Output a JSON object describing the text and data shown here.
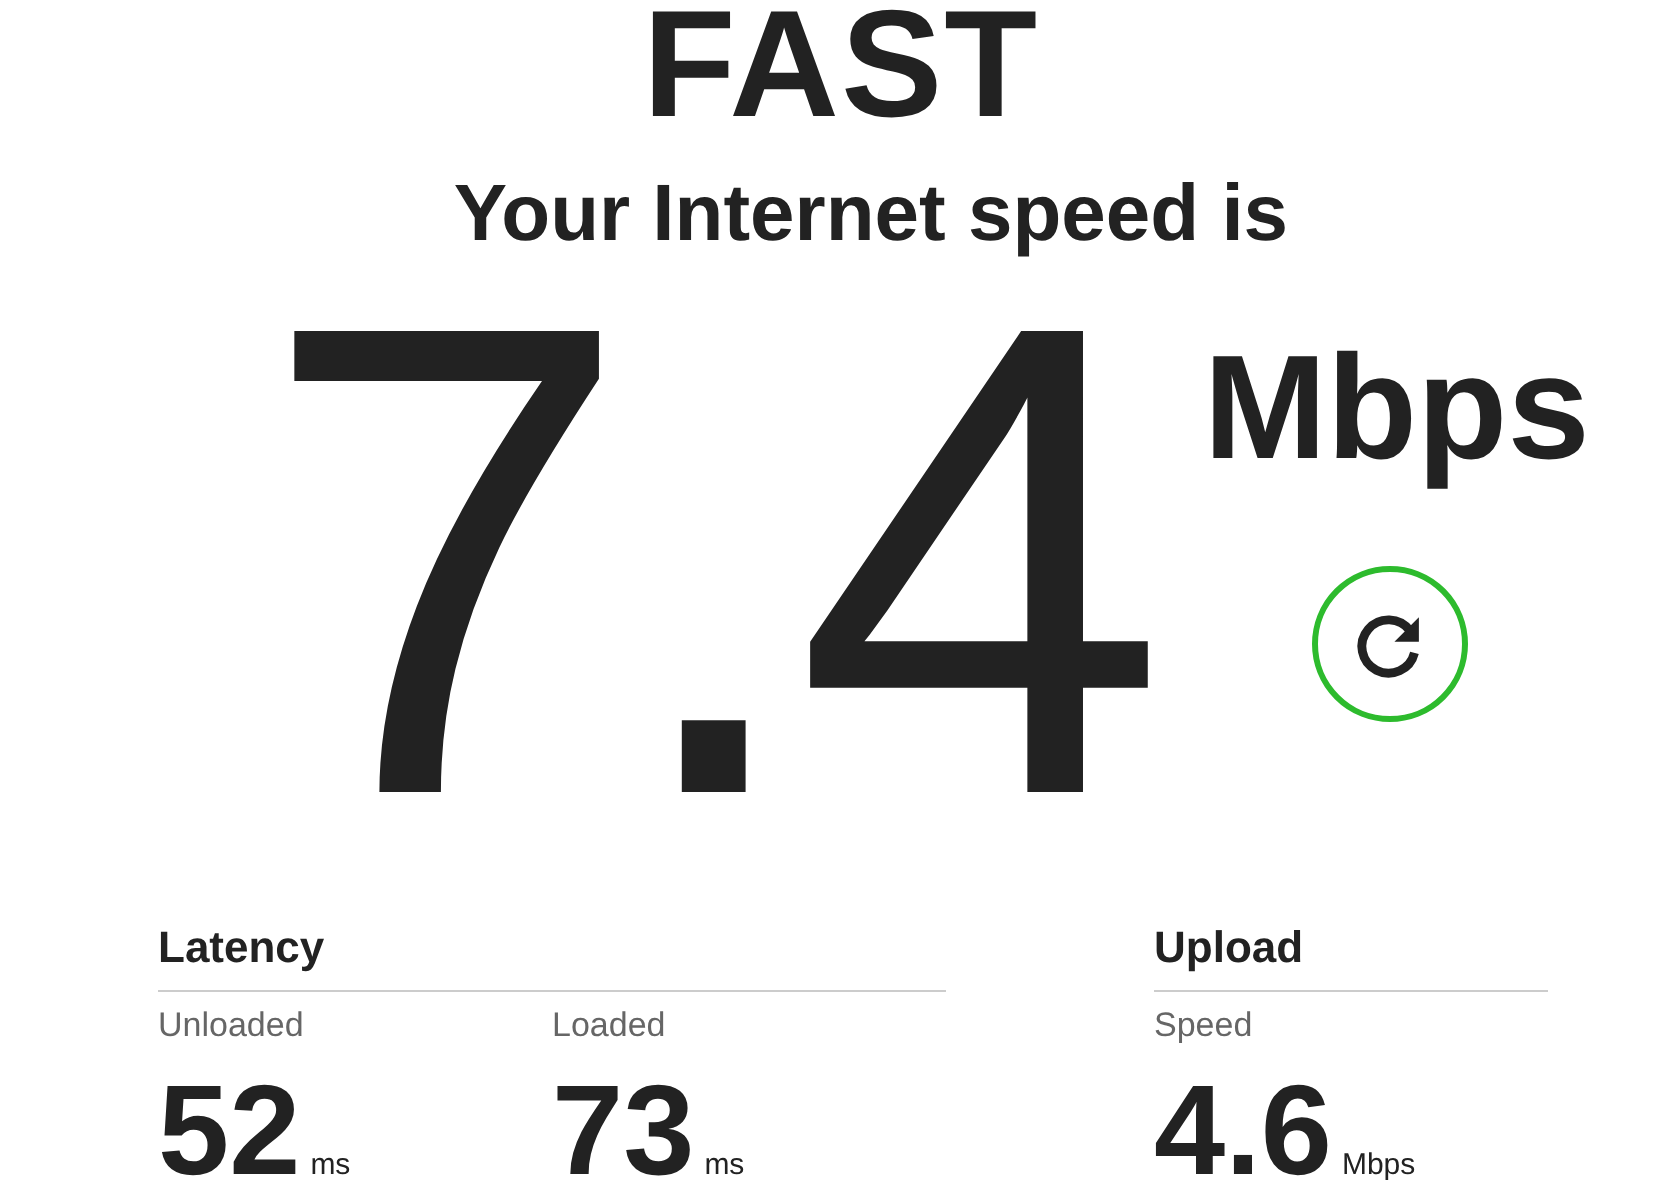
{
  "logo": "FAST",
  "headline": "Your Internet speed is",
  "speed": {
    "value": "7.4",
    "unit": "Mbps"
  },
  "sections": [
    {
      "title": "Latency",
      "metrics": [
        {
          "label": "Unloaded",
          "value": "52",
          "unit": "ms"
        },
        {
          "label": "Loaded",
          "value": "73",
          "unit": "ms"
        }
      ]
    },
    {
      "title": "Upload",
      "metrics": [
        {
          "label": "Speed",
          "value": "4.6",
          "unit": "Mbps"
        }
      ]
    }
  ]
}
